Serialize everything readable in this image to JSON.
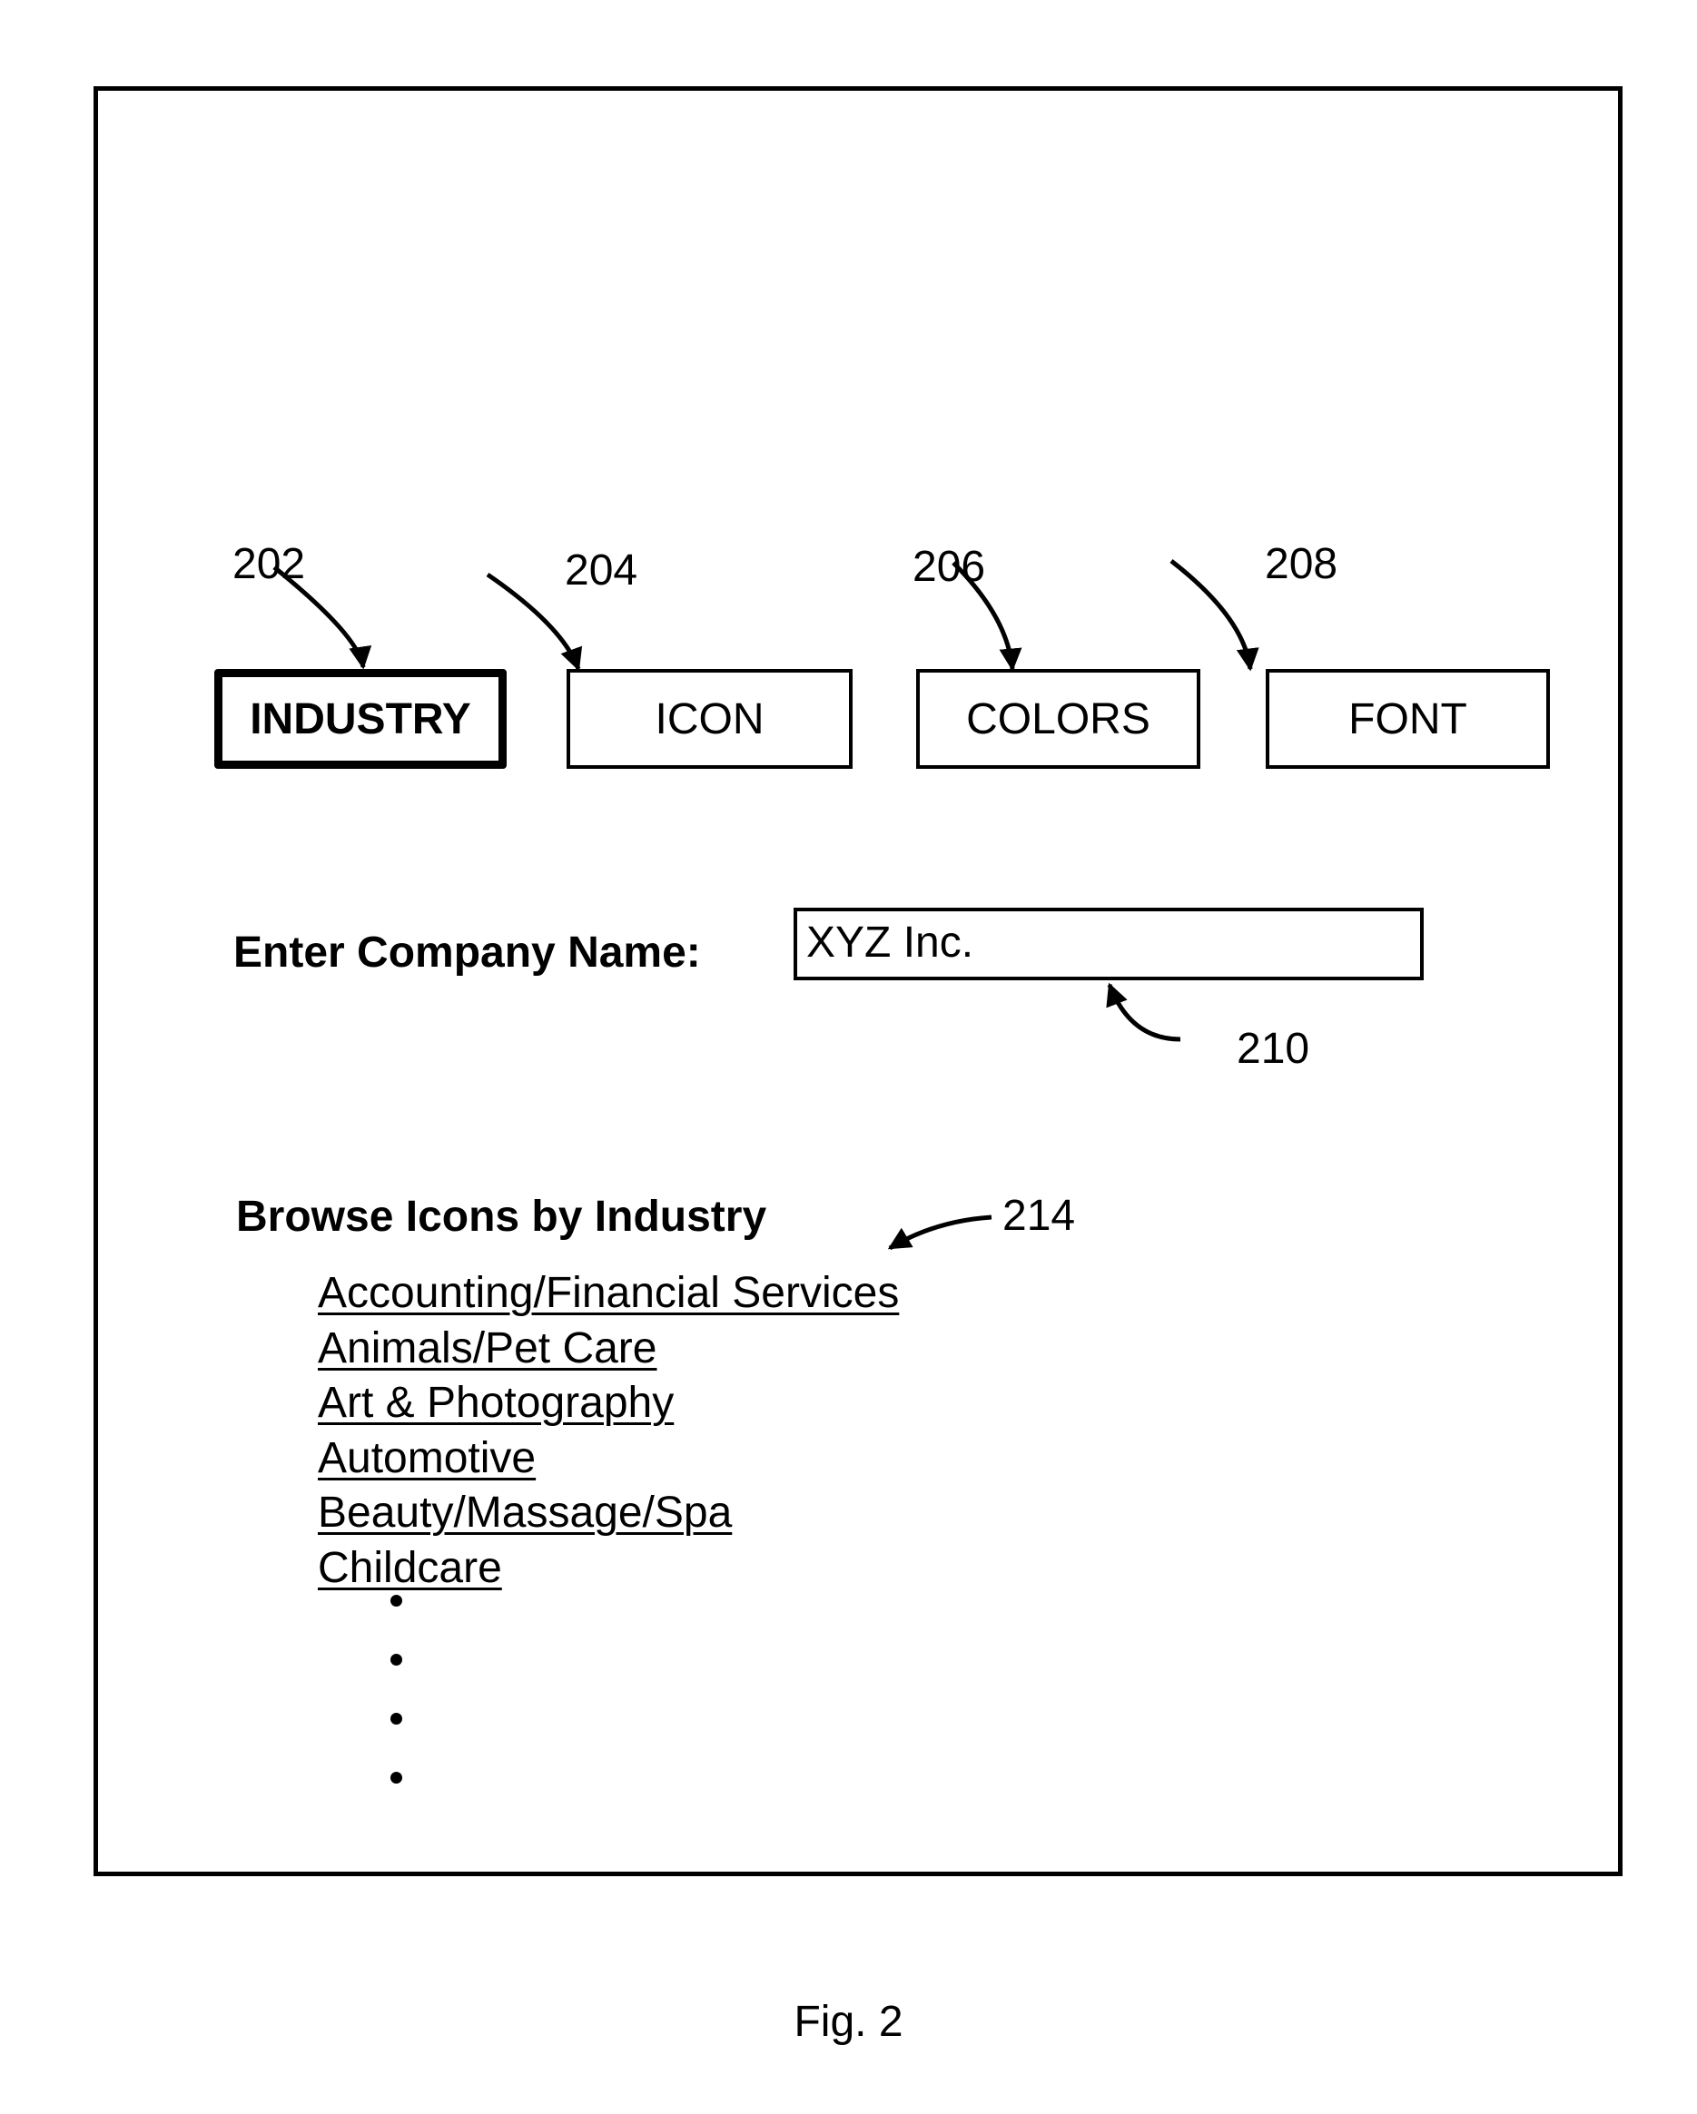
{
  "tabs": [
    {
      "label": "INDUSTRY",
      "ref": "202",
      "active": true
    },
    {
      "label": "ICON",
      "ref": "204",
      "active": false
    },
    {
      "label": "COLORS",
      "ref": "206",
      "active": false
    },
    {
      "label": "FONT",
      "ref": "208",
      "active": false
    }
  ],
  "company": {
    "label": "Enter Company Name:",
    "value": "XYZ Inc.",
    "ref": "210"
  },
  "browse": {
    "heading": "Browse Icons by Industry",
    "ref": "214",
    "items": [
      "Accounting/Financial Services",
      "Animals/Pet Care",
      "Art & Photography",
      "Automotive",
      "Beauty/Massage/Spa",
      "Childcare"
    ],
    "continuation": "more items (ellipsis)"
  },
  "caption": "Fig. 2"
}
